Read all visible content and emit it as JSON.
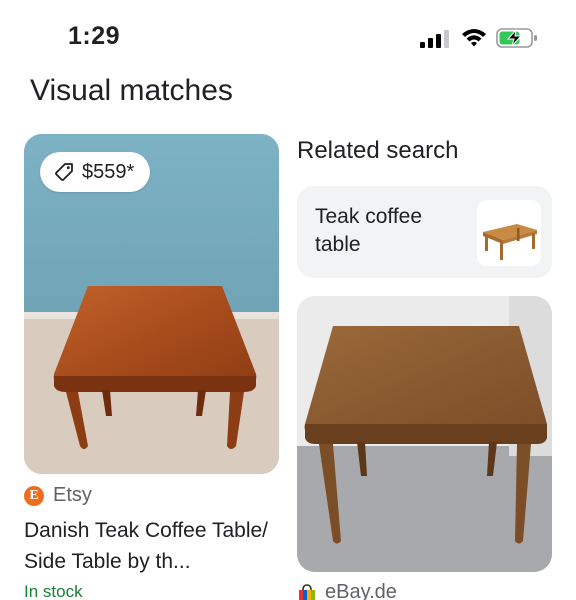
{
  "status_bar": {
    "time": "1:29"
  },
  "page": {
    "title": "Visual matches"
  },
  "left_result": {
    "price": "$559*",
    "source": "Etsy",
    "title": "Danish Teak Coffee Table/ Side Table by th...",
    "stock": "In stock"
  },
  "related": {
    "heading": "Related search",
    "chip_label": "Teak coffee table"
  },
  "right_result": {
    "source": "eBay.de"
  },
  "icons": {
    "signal": "signal-icon",
    "wifi": "wifi-icon",
    "battery": "battery-charging-icon",
    "tag": "price-tag-icon",
    "etsy": "etsy-logo-icon",
    "ebay": "ebay-shopping-bag-icon"
  },
  "colors": {
    "stock_green": "#188038",
    "etsy_orange": "#eb6d20",
    "battery_green": "#34c759"
  }
}
